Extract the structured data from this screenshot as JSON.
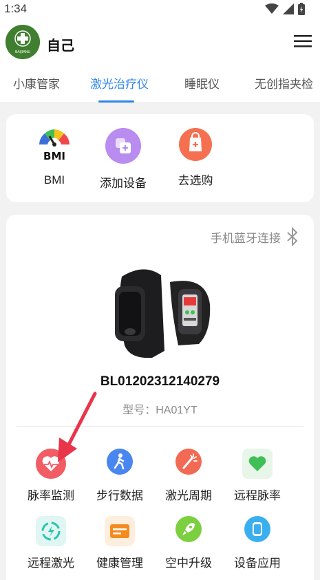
{
  "status_bar": {
    "time": "1:34"
  },
  "header": {
    "title": "自己",
    "avatar_text": "BAIJIANU"
  },
  "tabs": [
    {
      "label": "小康管家",
      "active": false
    },
    {
      "label": "激光治疗仪",
      "active": true
    },
    {
      "label": "睡眠仪",
      "active": false
    },
    {
      "label": "无创指夹检",
      "active": false
    }
  ],
  "quick_actions": [
    {
      "label": "BMI",
      "icon": "bmi-gauge-icon",
      "icon_text": "BMI"
    },
    {
      "label": "添加设备",
      "icon": "add-device-icon",
      "color": "#b98cf0"
    },
    {
      "label": "去选购",
      "icon": "shopping-bag-icon",
      "color": "#f56f51"
    }
  ],
  "device": {
    "connection_label": "手机蓝牙连接",
    "serial": "BL01202312140279",
    "model_label": "型号：HA01YT"
  },
  "functions": [
    {
      "label": "脉率监测",
      "icon": "heart-rate-icon",
      "color": "#f25c64"
    },
    {
      "label": "步行数据",
      "icon": "walking-icon",
      "color": "#4a86f0"
    },
    {
      "label": "激光周期",
      "icon": "laser-cycle-icon",
      "color": "#f26a53"
    },
    {
      "label": "远程脉率",
      "icon": "remote-heart-icon",
      "color": "#3fbf55"
    },
    {
      "label": "远程激光",
      "icon": "remote-laser-icon",
      "color": "#2bc4b0"
    },
    {
      "label": "健康管理",
      "icon": "health-card-icon",
      "color": "#f58a1f"
    },
    {
      "label": "空中升级",
      "icon": "rocket-icon",
      "color": "#7ccf3e"
    },
    {
      "label": "设备应用",
      "icon": "device-app-icon",
      "color": "#3aaff0"
    }
  ]
}
